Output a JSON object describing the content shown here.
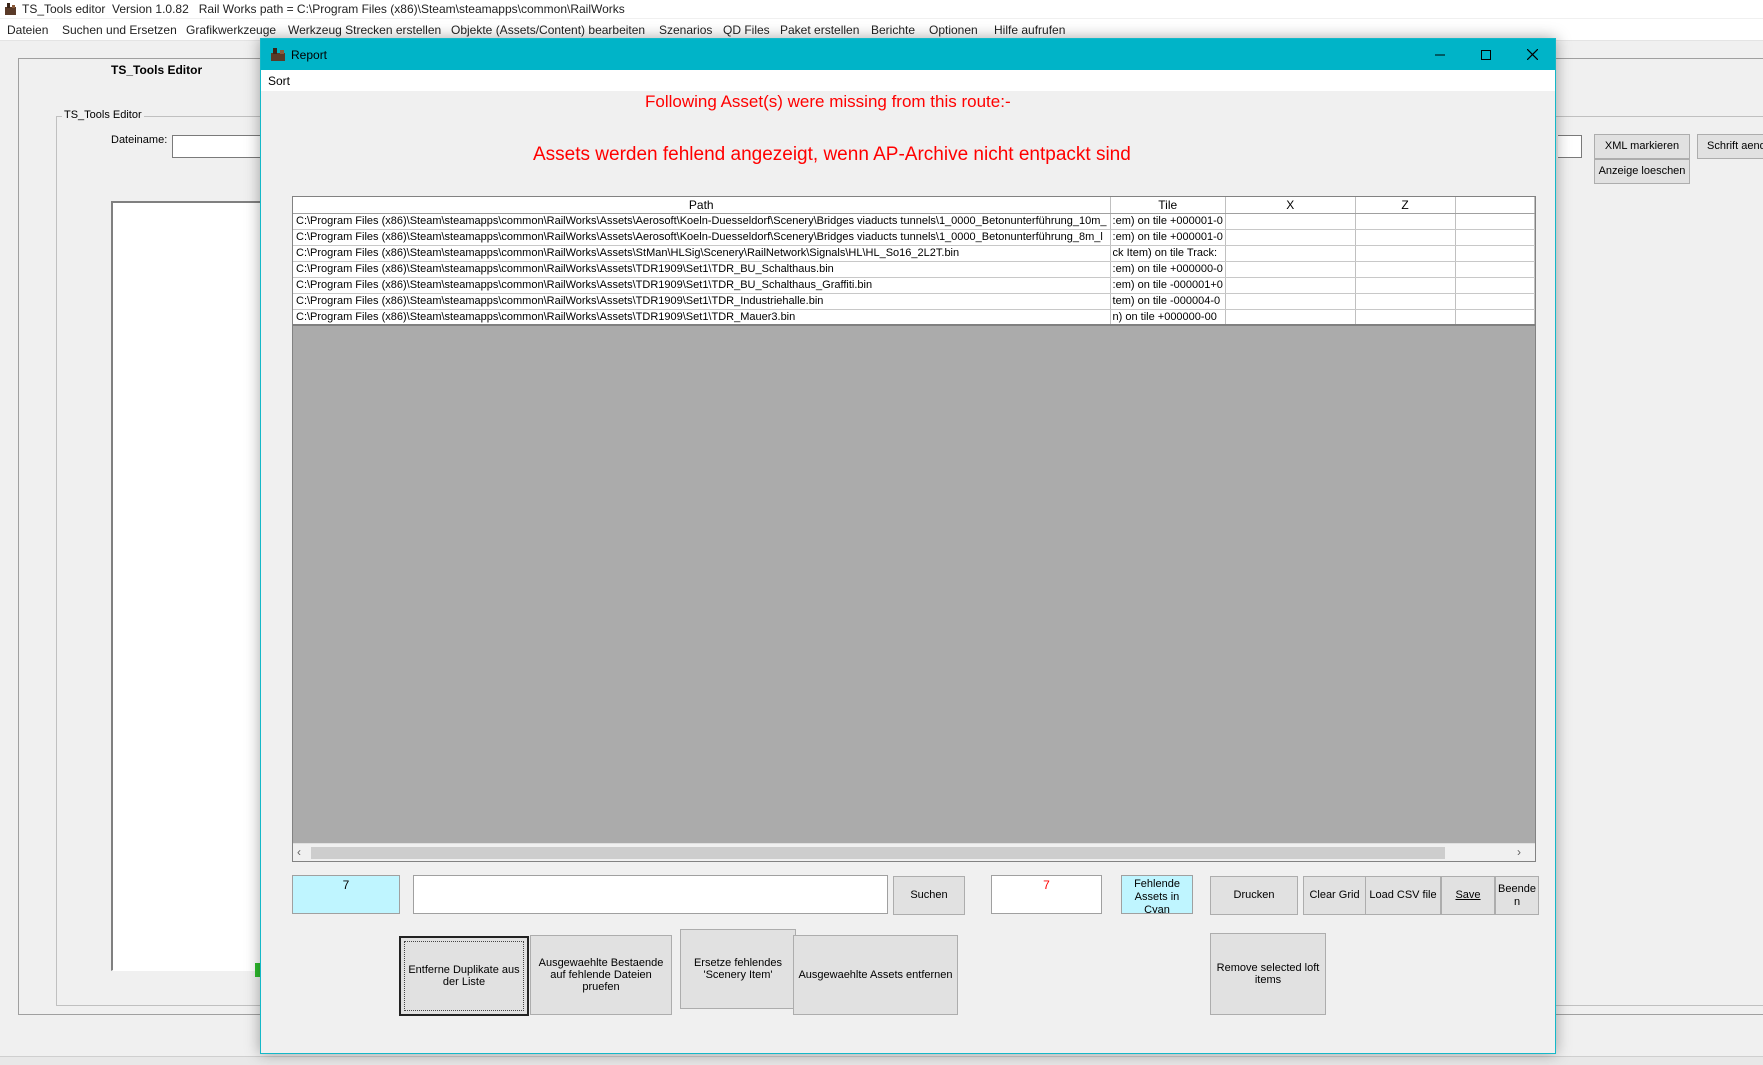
{
  "app": {
    "title": "TS_Tools editor  Version 1.0.82   Rail Works path = C:\\Program Files (x86)\\Steam\\steamapps\\common\\RailWorks",
    "menu": [
      "Dateien",
      "Suchen und Ersetzen",
      "Grafikwerkzeuge",
      "Werkzeug Strecken erstellen",
      "Objekte (Assets/Content) bearbeiten",
      "Szenarios",
      "QD Files",
      "Paket erstellen",
      "Berichte",
      "Optionen",
      "Hilfe aufrufen"
    ],
    "main_label": "TS_Tools Editor",
    "inner_label": "TS_Tools Editor",
    "dateiname_label": "Dateiname:",
    "xml_button": "XML markieren",
    "anzeige_button": "Anzeige loeschen",
    "schrift_button": "Schrift aend"
  },
  "report": {
    "title": "Report",
    "menu_sort": "Sort",
    "message1": "Following Asset(s) were missing from this route:-",
    "message2": "Assets werden fehlend angezeigt, wenn AP-Archive nicht entpackt sind",
    "columns": [
      "Path",
      "Tile",
      "X",
      "Z",
      ""
    ],
    "rows": [
      {
        "path": "C:\\Program Files (x86)\\Steam\\steamapps\\common\\RailWorks\\Assets\\Aerosoft\\Koeln-Duesseldorf\\Scenery\\Bridges viaducts tunnels\\1_0000_Betonunterführung_10m_",
        "tile": ":em) on tile +000001-0"
      },
      {
        "path": "C:\\Program Files (x86)\\Steam\\steamapps\\common\\RailWorks\\Assets\\Aerosoft\\Koeln-Duesseldorf\\Scenery\\Bridges viaducts tunnels\\1_0000_Betonunterführung_8m_l",
        "tile": ":em) on tile +000001-0"
      },
      {
        "path": "C:\\Program Files (x86)\\Steam\\steamapps\\common\\RailWorks\\Assets\\StMan\\HLSig\\Scenery\\RailNetwork\\Signals\\HL\\HL_So16_2L2T.bin",
        "tile": "ck Item) on tile Track:"
      },
      {
        "path": "C:\\Program Files (x86)\\Steam\\steamapps\\common\\RailWorks\\Assets\\TDR1909\\Set1\\TDR_BU_Schalthaus.bin",
        "tile": ":em) on tile +000000-0"
      },
      {
        "path": "C:\\Program Files (x86)\\Steam\\steamapps\\common\\RailWorks\\Assets\\TDR1909\\Set1\\TDR_BU_Schalthaus_Graffiti.bin",
        "tile": ":em) on tile -000001+0"
      },
      {
        "path": "C:\\Program Files (x86)\\Steam\\steamapps\\common\\RailWorks\\Assets\\TDR1909\\Set1\\TDR_Industriehalle.bin",
        "tile": "tem) on tile -000004-0"
      },
      {
        "path": "C:\\Program Files (x86)\\Steam\\steamapps\\common\\RailWorks\\Assets\\TDR1909\\Set1\\TDR_Mauer3.bin",
        "tile": "n) on tile +000000-00"
      }
    ],
    "count": "7",
    "search_value": "",
    "suchen_button": "Suchen",
    "red_count": "7",
    "fehlende_label": "Fehlende Assets in Cyan",
    "drucken_button": "Drucken",
    "clear_grid_button": "Clear Grid",
    "load_csv_button": "Load CSV file",
    "save_button": "Save",
    "beenden_button": "Beende n",
    "duplikate_button": "Entferne Duplikate aus der Liste",
    "pruefen_button": "Ausgewaehlte Bestaende auf fehlende Dateien pruefen",
    "ersetze_button": "Ersetze fehlendes 'Scenery Item'",
    "entfernen_button": "Ausgewaehlte Assets entfernen",
    "remove_loft_button": "Remove selected loft items"
  },
  "colors": {
    "titlebar_accent": "#00b4c8",
    "message_red": "#ff0000",
    "cyan_box": "#bff5ff",
    "grid_empty": "#ababab"
  }
}
